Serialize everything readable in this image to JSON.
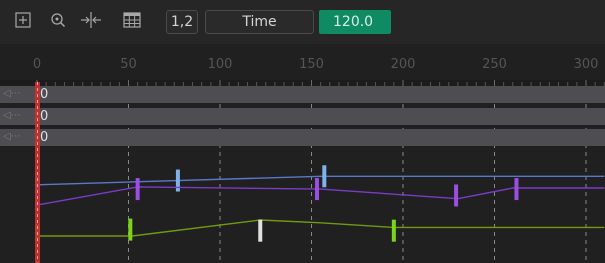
{
  "toolbar": {
    "icons": [
      "expand-all-icon",
      "zoom-icon",
      "fit-width-icon",
      "grid-icon"
    ],
    "mode_label": "1,2",
    "field_label": "Time",
    "time_value": "120.0"
  },
  "ruler": {
    "labels": [
      "0",
      "50",
      "100",
      "150",
      "200",
      "250",
      "300"
    ]
  },
  "tracks": [
    {
      "value": "0"
    },
    {
      "value": "0"
    },
    {
      "value": "0"
    }
  ],
  "colors": {
    "playhead": "#c43030",
    "value_field": "#0f8a63",
    "curve_blue": "#5b78c8",
    "curve_purple": "#7a3cc6",
    "curve_green": "#6f9a12",
    "key_blue": "#7fb2e8",
    "key_purple": "#9b4fe0",
    "key_green": "#7ad41a",
    "key_white": "#e0e0e0"
  },
  "chart_data": {
    "type": "line",
    "xlim": [
      0,
      310
    ],
    "series": [
      {
        "color": "#5b78c8",
        "points": [
          [
            0,
            2.4
          ],
          [
            155,
            2.8
          ],
          [
            310,
            2.8
          ]
        ],
        "keys": [
          [
            77,
            2.6,
            "#7fb2e8"
          ],
          [
            157,
            2.8,
            "#7fb2e8"
          ]
        ]
      },
      {
        "color": "#7a3cc6",
        "points": [
          [
            0,
            1.45
          ],
          [
            55,
            2.3
          ],
          [
            155,
            2.2
          ],
          [
            230,
            1.75
          ],
          [
            260,
            2.25
          ],
          [
            310,
            2.25
          ]
        ],
        "keys": [
          [
            55,
            2.2,
            "#9b4fe0"
          ],
          [
            153,
            2.2,
            "#9b4fe0"
          ],
          [
            229,
            1.9,
            "#9b4fe0"
          ],
          [
            262,
            2.2,
            "#9b4fe0"
          ]
        ]
      },
      {
        "color": "#6f9a12",
        "points": [
          [
            0,
            0.0
          ],
          [
            52,
            0.0
          ],
          [
            122,
            0.75
          ],
          [
            155,
            0.62
          ],
          [
            195,
            0.4
          ],
          [
            310,
            0.4
          ]
        ],
        "keys": [
          [
            51,
            0.3,
            "#7ad41a"
          ],
          [
            122,
            0.25,
            "#e0e0e0"
          ],
          [
            195,
            0.25,
            "#7ad41a"
          ]
        ]
      }
    ]
  }
}
